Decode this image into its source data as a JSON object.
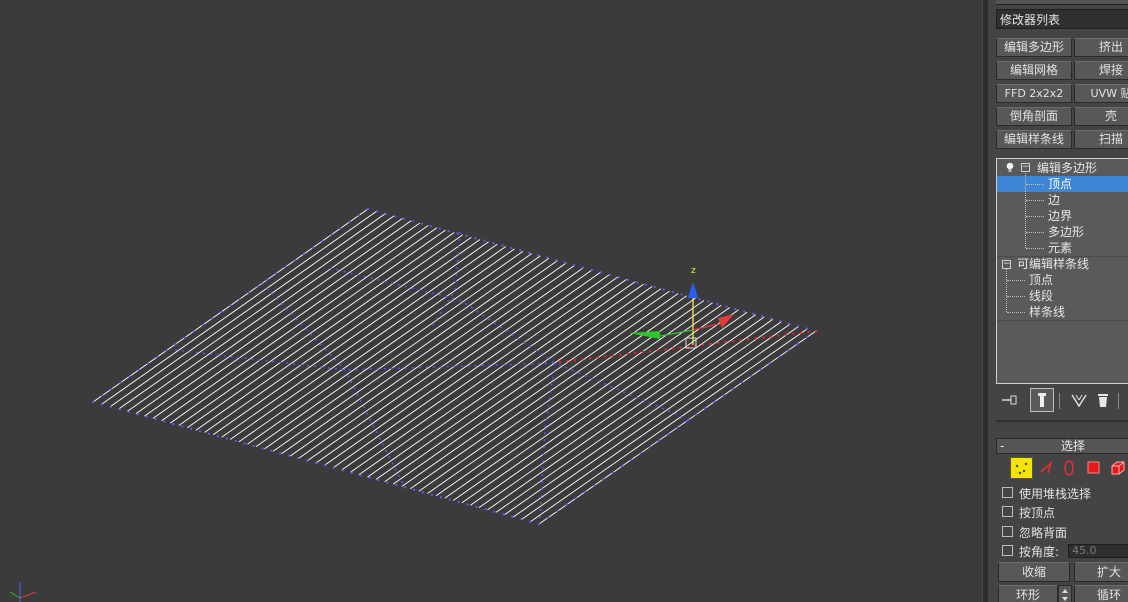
{
  "modifier_list": {
    "label": "修改器列表"
  },
  "modifier_buttons": [
    "编辑多边形",
    "挤出",
    "编辑网格",
    "焊接",
    "FFD 2x2x2",
    "UVW 贴",
    "倒角剖面",
    "壳",
    "编辑样条线",
    "扫描"
  ],
  "stack": {
    "items": [
      {
        "label": "编辑多边形",
        "level": 0
      },
      {
        "label": "顶点",
        "level": 1,
        "selected": true
      },
      {
        "label": "边",
        "level": 1
      },
      {
        "label": "边界",
        "level": 1
      },
      {
        "label": "多边形",
        "level": 1
      },
      {
        "label": "元素",
        "level": 1
      },
      {
        "label": "可编辑样条线",
        "level": 0
      },
      {
        "label": "顶点",
        "level": 1
      },
      {
        "label": "线段",
        "level": 1
      },
      {
        "label": "样条线",
        "level": 1
      }
    ]
  },
  "stack_tools": [
    "pin-stack-icon",
    "show-end-result-icon",
    "make-unique-icon",
    "remove-modifier-icon"
  ],
  "selection_rollout": {
    "collapse": "-",
    "title": "选择",
    "level_icons": [
      "vertex-icon",
      "edge-icon",
      "border-icon",
      "polygon-icon",
      "element-icon"
    ],
    "options": [
      {
        "label": "使用堆栈选择",
        "checked": false
      },
      {
        "label": "按顶点",
        "checked": false
      },
      {
        "label": "忽略背面",
        "checked": false
      },
      {
        "label": "按角度:",
        "checked": false
      }
    ],
    "angle_value": "45.0",
    "shrink_label": "收缩",
    "grow_label": "扩大",
    "ring_label": "环形",
    "loop_label": "循环"
  },
  "gizmo": {
    "z_label": "z"
  },
  "colors": {
    "viewport_bg": "#3b3b3b",
    "wire": "#ffffff",
    "vertex": "#5a5aff",
    "selected_vertex": "#ff2020",
    "stack_select": "#3d86d6"
  }
}
